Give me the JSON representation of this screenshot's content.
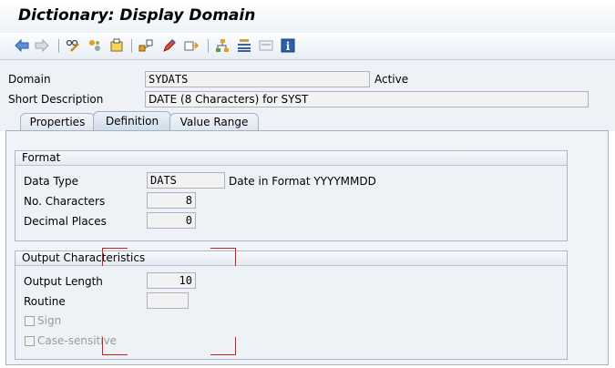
{
  "window": {
    "title": "Dictionary: Display Domain"
  },
  "toolbar": {
    "icons": [
      "back-arrow-icon",
      "forward-arrow-icon",
      "display-change-icon",
      "other-object-icon",
      "activate-icon",
      "where-used-icon",
      "edit-icon",
      "check-icon",
      "hierarchy-icon",
      "list-icon",
      "frame-icon",
      "info-icon"
    ]
  },
  "header": {
    "domain_label": "Domain",
    "domain_value": "SYDATS",
    "status": "Active",
    "short_desc_label": "Short Description",
    "short_desc_value": "DATE (8 Characters) for SYST"
  },
  "tabs": [
    {
      "label": "Properties"
    },
    {
      "label": "Definition"
    },
    {
      "label": "Value Range"
    }
  ],
  "format": {
    "title": "Format",
    "data_type_label": "Data Type",
    "data_type_value": "DATS",
    "data_type_desc": "Date in Format YYYYMMDD",
    "no_chars_label": "No. Characters",
    "no_chars_value": "8",
    "decimal_label": "Decimal Places",
    "decimal_value": "0"
  },
  "output": {
    "title": "Output Characteristics",
    "length_label": "Output Length",
    "length_value": "10",
    "routine_label": "Routine",
    "routine_value": "",
    "sign_label": "Sign",
    "case_label": "Case-sensitive"
  },
  "colors": {
    "highlight": "#cc1f1f",
    "tab_border": "#a3b1c1"
  }
}
